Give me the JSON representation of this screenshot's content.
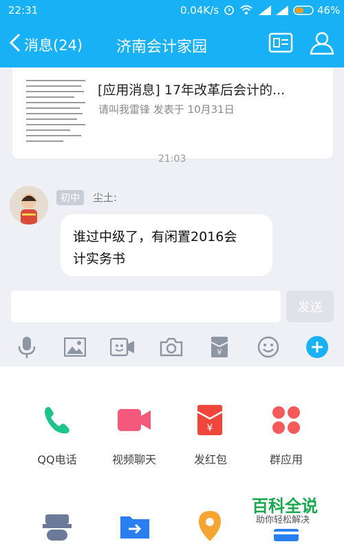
{
  "status_bar": {
    "time": "22:31",
    "speed": "0.04K/s",
    "battery": "46%"
  },
  "header": {
    "back_label": "消息(24)",
    "title": "济南会计家园"
  },
  "app_message": {
    "title": "[应用消息] 17年改革后会计的...",
    "meta": "请叫我雷锋 发表于 10月31日"
  },
  "timestamp": "21:03",
  "message": {
    "badge": "初中",
    "sender": "尘土:",
    "text_line1": "谁过中级了，有闲置2016会",
    "text_line2": "计实务书"
  },
  "input": {
    "send_label": "发送",
    "placeholder": ""
  },
  "panel_apps": [
    {
      "label": "QQ电话",
      "icon": "phone-icon",
      "color": "#1ec28b"
    },
    {
      "label": "视频聊天",
      "icon": "video-icon",
      "color": "#f4587a"
    },
    {
      "label": "发红包",
      "icon": "red-packet-icon",
      "color": "#f0473d"
    },
    {
      "label": "群应用",
      "icon": "group-apps-icon",
      "color": "#f55a5a"
    }
  ],
  "watermark": {
    "title": "百科全说",
    "subtitle": "助你轻松解决"
  },
  "colors": {
    "header": "#19b1f6",
    "accent": "#19b1f6"
  }
}
